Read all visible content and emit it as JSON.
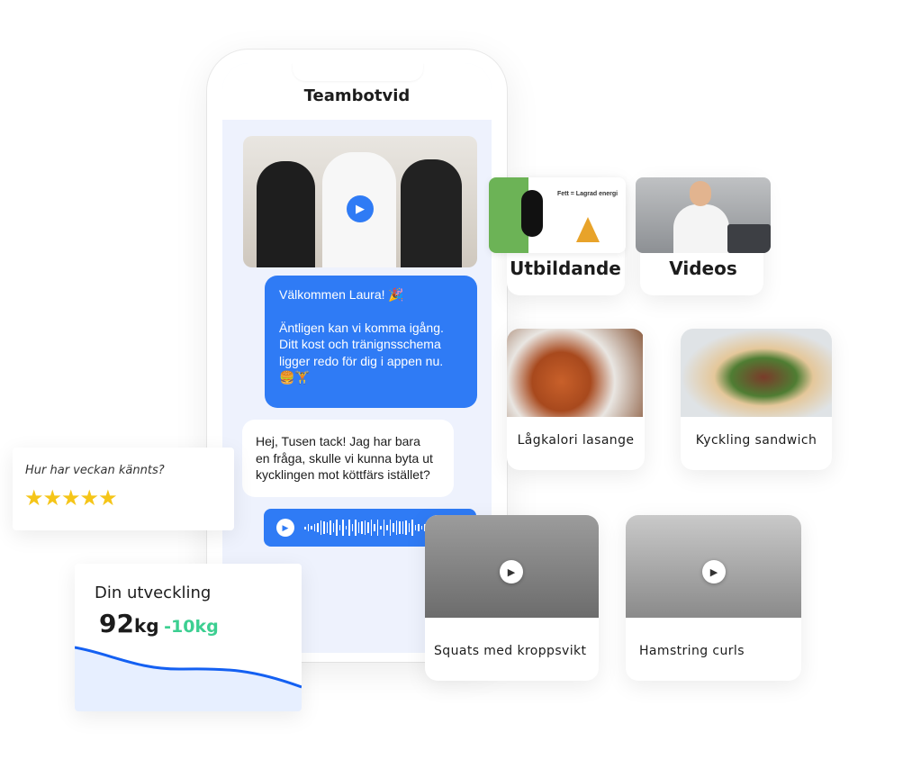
{
  "phone": {
    "title": "Teambotvid"
  },
  "chat": {
    "welcome_lines": [
      "Välkommen Laura! 🎉",
      "",
      "Äntligen kan vi komma igång.",
      "Ditt kost och tränignsschema",
      "ligger redo för dig i appen nu.",
      "🍔🏋"
    ],
    "reply_lines": [
      "Hej, Tusen tack! Jag har bara",
      "en fråga, skulle vi kunna byta ut",
      "kycklingen mot köttfärs istället?"
    ]
  },
  "rating": {
    "question": "Hur har veckan kännts?",
    "stars": 5,
    "max": 5,
    "star_color": "#f5c518"
  },
  "progress": {
    "title": "Din utveckling",
    "weight": "92",
    "unit": "kg",
    "change": "-10kg",
    "change_color": "#3ccf91",
    "line_color": "#1460f2"
  },
  "categories": [
    {
      "label": "Utbildande",
      "slide_title": "Fett = Lagrad energi"
    },
    {
      "label": "Videos"
    }
  ],
  "recipes": [
    {
      "label": "Lågkalori lasange"
    },
    {
      "label": "Kyckling sandwich"
    }
  ],
  "exercises": [
    {
      "label": "Squats med kroppsvikt"
    },
    {
      "label": "Hamstring curls"
    }
  ],
  "colors": {
    "accent": "#2f7bf5",
    "chat_bg": "#eef2fd"
  }
}
